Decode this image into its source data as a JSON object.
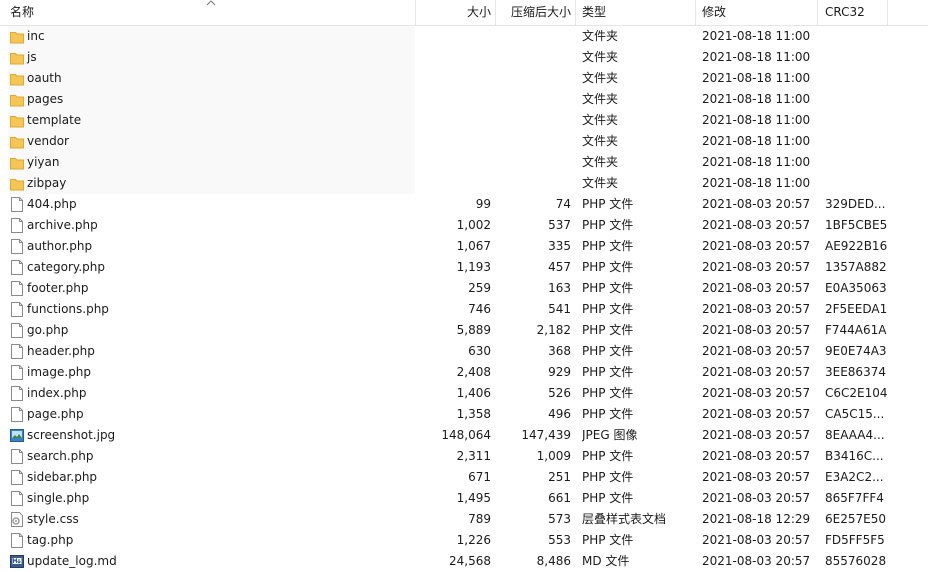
{
  "columns": {
    "name": "名称",
    "size": "大小",
    "packed": "压缩后大小",
    "type": "类型",
    "modified": "修改",
    "crc": "CRC32"
  },
  "rows": [
    {
      "name": "inc",
      "size": "",
      "packed": "",
      "type": "文件夹",
      "modified": "2021-08-18 11:00",
      "crc": "",
      "icon": "folder-icon"
    },
    {
      "name": "js",
      "size": "",
      "packed": "",
      "type": "文件夹",
      "modified": "2021-08-18 11:00",
      "crc": "",
      "icon": "folder-icon"
    },
    {
      "name": "oauth",
      "size": "",
      "packed": "",
      "type": "文件夹",
      "modified": "2021-08-18 11:00",
      "crc": "",
      "icon": "folder-icon"
    },
    {
      "name": "pages",
      "size": "",
      "packed": "",
      "type": "文件夹",
      "modified": "2021-08-18 11:00",
      "crc": "",
      "icon": "folder-icon"
    },
    {
      "name": "template",
      "size": "",
      "packed": "",
      "type": "文件夹",
      "modified": "2021-08-18 11:00",
      "crc": "",
      "icon": "folder-icon"
    },
    {
      "name": "vendor",
      "size": "",
      "packed": "",
      "type": "文件夹",
      "modified": "2021-08-18 11:00",
      "crc": "",
      "icon": "folder-icon"
    },
    {
      "name": "yiyan",
      "size": "",
      "packed": "",
      "type": "文件夹",
      "modified": "2021-08-18 11:00",
      "crc": "",
      "icon": "folder-icon"
    },
    {
      "name": "zibpay",
      "size": "",
      "packed": "",
      "type": "文件夹",
      "modified": "2021-08-18 11:00",
      "crc": "",
      "icon": "folder-icon"
    },
    {
      "name": "404.php",
      "size": "99",
      "packed": "74",
      "type": "PHP 文件",
      "modified": "2021-08-03 20:57",
      "crc": "329DED...",
      "icon": "file-icon"
    },
    {
      "name": "archive.php",
      "size": "1,002",
      "packed": "537",
      "type": "PHP 文件",
      "modified": "2021-08-03 20:57",
      "crc": "1BF5CBE5",
      "icon": "file-icon"
    },
    {
      "name": "author.php",
      "size": "1,067",
      "packed": "335",
      "type": "PHP 文件",
      "modified": "2021-08-03 20:57",
      "crc": "AE922B16",
      "icon": "file-icon"
    },
    {
      "name": "category.php",
      "size": "1,193",
      "packed": "457",
      "type": "PHP 文件",
      "modified": "2021-08-03 20:57",
      "crc": "1357A882",
      "icon": "file-icon"
    },
    {
      "name": "footer.php",
      "size": "259",
      "packed": "163",
      "type": "PHP 文件",
      "modified": "2021-08-03 20:57",
      "crc": "E0A35063",
      "icon": "file-icon"
    },
    {
      "name": "functions.php",
      "size": "746",
      "packed": "541",
      "type": "PHP 文件",
      "modified": "2021-08-03 20:57",
      "crc": "2F5EEDA1",
      "icon": "file-icon"
    },
    {
      "name": "go.php",
      "size": "5,889",
      "packed": "2,182",
      "type": "PHP 文件",
      "modified": "2021-08-03 20:57",
      "crc": "F744A61A",
      "icon": "file-icon"
    },
    {
      "name": "header.php",
      "size": "630",
      "packed": "368",
      "type": "PHP 文件",
      "modified": "2021-08-03 20:57",
      "crc": "9E0E74A3",
      "icon": "file-icon"
    },
    {
      "name": "image.php",
      "size": "2,408",
      "packed": "929",
      "type": "PHP 文件",
      "modified": "2021-08-03 20:57",
      "crc": "3EE86374",
      "icon": "file-icon"
    },
    {
      "name": "index.php",
      "size": "1,406",
      "packed": "526",
      "type": "PHP 文件",
      "modified": "2021-08-03 20:57",
      "crc": "C6C2E104",
      "icon": "file-icon"
    },
    {
      "name": "page.php",
      "size": "1,358",
      "packed": "496",
      "type": "PHP 文件",
      "modified": "2021-08-03 20:57",
      "crc": "CA5C15...",
      "icon": "file-icon"
    },
    {
      "name": "screenshot.jpg",
      "size": "148,064",
      "packed": "147,439",
      "type": "JPEG 图像",
      "modified": "2021-08-03 20:57",
      "crc": "8EAAA4...",
      "icon": "image-file-icon"
    },
    {
      "name": "search.php",
      "size": "2,311",
      "packed": "1,009",
      "type": "PHP 文件",
      "modified": "2021-08-03 20:57",
      "crc": "B3416C...",
      "icon": "file-icon"
    },
    {
      "name": "sidebar.php",
      "size": "671",
      "packed": "251",
      "type": "PHP 文件",
      "modified": "2021-08-03 20:57",
      "crc": "E3A2C2...",
      "icon": "file-icon"
    },
    {
      "name": "single.php",
      "size": "1,495",
      "packed": "661",
      "type": "PHP 文件",
      "modified": "2021-08-03 20:57",
      "crc": "865F7FF4",
      "icon": "file-icon"
    },
    {
      "name": "style.css",
      "size": "789",
      "packed": "573",
      "type": "层叠样式表文档",
      "modified": "2021-08-18 12:29",
      "crc": "6E257E50",
      "icon": "css-file-icon"
    },
    {
      "name": "tag.php",
      "size": "1,226",
      "packed": "553",
      "type": "PHP 文件",
      "modified": "2021-08-03 20:57",
      "crc": "FD5FF5F5",
      "icon": "file-icon"
    },
    {
      "name": "update_log.md",
      "size": "24,568",
      "packed": "8,486",
      "type": "MD 文件",
      "modified": "2021-08-03 20:57",
      "crc": "85576028",
      "icon": "md-file-icon"
    }
  ],
  "colors": {
    "folder": "#f3c655",
    "folder_dark": "#e0a92f",
    "grid": "#e5e5e5"
  }
}
